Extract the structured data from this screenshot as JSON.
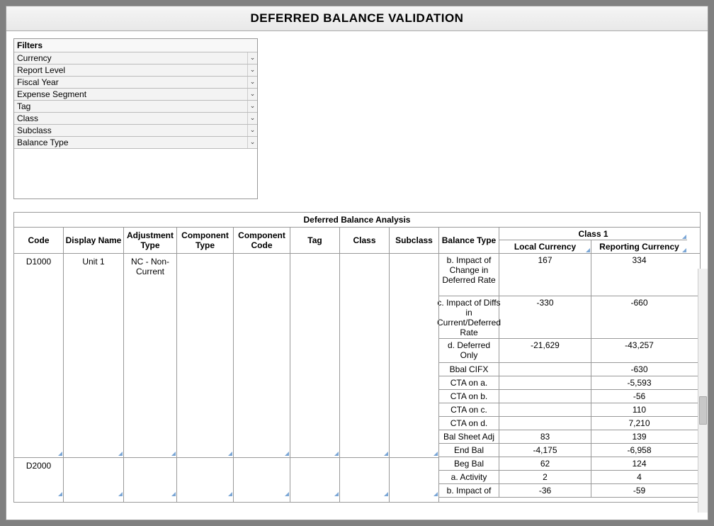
{
  "title": "DEFERRED BALANCE VALIDATION",
  "filters": {
    "header": "Filters",
    "items": [
      {
        "label": "Currency"
      },
      {
        "label": "Report Level"
      },
      {
        "label": "Fiscal Year"
      },
      {
        "label": "Expense Segment"
      },
      {
        "label": "Tag"
      },
      {
        "label": "Class"
      },
      {
        "label": "Subclass"
      },
      {
        "label": "Balance Type"
      }
    ]
  },
  "analysis": {
    "title": "Deferred Balance Analysis",
    "columns": {
      "code": "Code",
      "display": "Display Name",
      "adjustment": "Adjustment Type",
      "comp_type": "Component Type",
      "comp_code": "Component Code",
      "tag": "Tag",
      "class": "Class",
      "subclass": "Subclass",
      "balance_type": "Balance Type",
      "class_group": "Class 1",
      "local_currency": "Local Currency",
      "reporting_currency": "Reporting Currency"
    },
    "groups": [
      {
        "code": "D1000",
        "display_name": "Unit 1",
        "adjustment_type": "NC  - Non-Current",
        "rows": [
          {
            "balance_type": "b. Impact of Change in Deferred Rate",
            "local": "167",
            "report": "334",
            "h": "multi"
          },
          {
            "balance_type": "c. Impact of Diffs in Current/Deferred Rate",
            "local": "-330",
            "report": "-660",
            "h": "multi"
          },
          {
            "balance_type": "d. Deferred Only",
            "local": "-21,629",
            "report": "-43,257",
            "h": "medium"
          },
          {
            "balance_type": "Bbal CIFX",
            "local": "",
            "report": "-630",
            "h": ""
          },
          {
            "balance_type": "CTA on a.",
            "local": "",
            "report": "-5,593",
            "h": ""
          },
          {
            "balance_type": "CTA on b.",
            "local": "",
            "report": "-56",
            "h": ""
          },
          {
            "balance_type": "CTA on c.",
            "local": "",
            "report": "110",
            "h": ""
          },
          {
            "balance_type": "CTA on d.",
            "local": "",
            "report": "7,210",
            "h": ""
          },
          {
            "balance_type": "Bal Sheet Adj",
            "local": "83",
            "report": "139",
            "h": ""
          },
          {
            "balance_type": "End Bal",
            "local": "-4,175",
            "report": "-6,958",
            "h": ""
          }
        ]
      },
      {
        "code": "D2000",
        "display_name": "",
        "adjustment_type": "",
        "rows": [
          {
            "balance_type": "Beg Bal",
            "local": "62",
            "report": "124",
            "h": ""
          },
          {
            "balance_type": "a. Activity",
            "local": "2",
            "report": "4",
            "h": ""
          },
          {
            "balance_type": "b. Impact of",
            "local": "-36",
            "report": "-59",
            "h": ""
          }
        ]
      }
    ]
  }
}
